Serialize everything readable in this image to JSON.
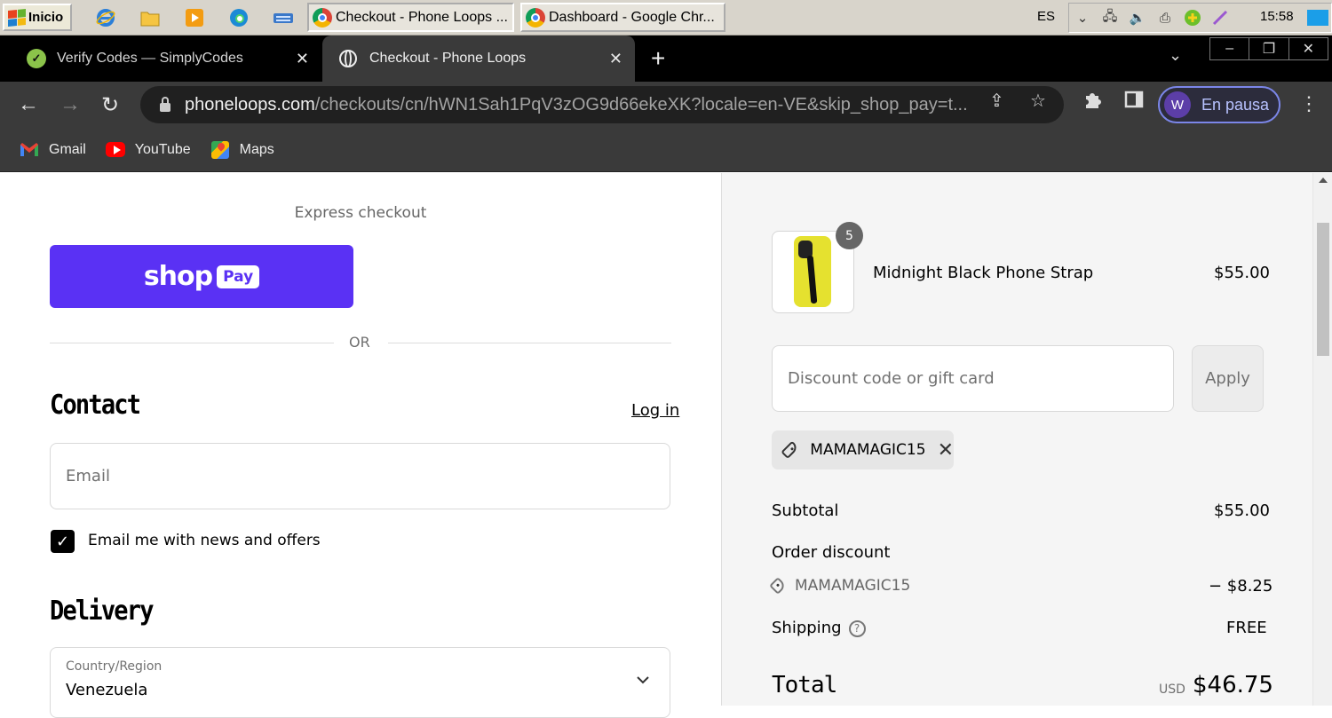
{
  "taskbar": {
    "start_label": "Inicio",
    "tasks": [
      {
        "label": "Checkout - Phone Loops ...",
        "active": true
      },
      {
        "label": "Dashboard - Google Chr...",
        "active": false
      }
    ],
    "language": "ES",
    "clock": "15:58"
  },
  "browser": {
    "tabs": [
      {
        "title": "Verify Codes — SimplyCodes",
        "active": false
      },
      {
        "title": "Checkout - Phone Loops",
        "active": true
      }
    ],
    "url_domain": "phoneloops.com",
    "url_path": "/checkouts/cn/hWN1Sah1PqV3zOG9d66ekeXK?locale=en-VE&skip_shop_pay=t...",
    "profile_initial": "W",
    "profile_label": "En pausa",
    "bookmarks": [
      "Gmail",
      "YouTube",
      "Maps"
    ]
  },
  "checkout": {
    "express_label": "Express checkout",
    "shoppay_shop": "shop",
    "shoppay_pay": "Pay",
    "or_label": "OR",
    "contact_heading": "Contact",
    "login_link": "Log in",
    "email_placeholder": "Email",
    "news_label": "Email me with news and offers",
    "news_checked": true,
    "delivery_heading": "Delivery",
    "country_label": "Country/Region",
    "country_value": "Venezuela"
  },
  "summary": {
    "product_name": "Midnight Black Phone Strap",
    "product_price": "$55.00",
    "quantity": "5",
    "discount_placeholder": "Discount code or gift card",
    "apply_label": "Apply",
    "applied_code": "MAMAMAGIC15",
    "subtotal_label": "Subtotal",
    "subtotal_value": "$55.00",
    "order_discount_label": "Order discount",
    "discount_code": "MAMAMAGIC15",
    "discount_value": "− $8.25",
    "shipping_label": "Shipping",
    "shipping_value": "FREE",
    "total_label": "Total",
    "currency": "USD",
    "total_value": "$46.75"
  },
  "colors": {
    "shoppay": "#5a31f4",
    "summary_bg": "#f5f5f5",
    "profile_border": "#7b86e8"
  }
}
